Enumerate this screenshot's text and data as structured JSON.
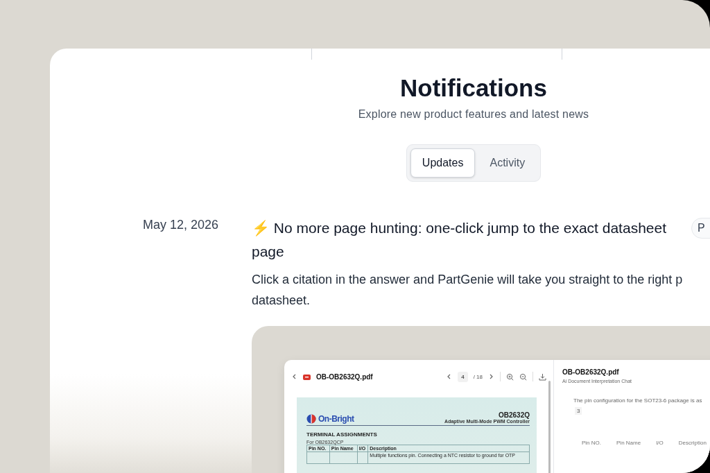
{
  "header": {
    "title": "Notifications",
    "subtitle": "Explore new product features and latest news"
  },
  "tabs": [
    {
      "label": "Updates",
      "selected": true
    },
    {
      "label": "Activity",
      "selected": false
    }
  ],
  "entries": [
    {
      "date": "May 12, 2026",
      "title": "⚡ No more page hunting: one-click jump to the exact datasheet page",
      "tag": "P",
      "body_lines": [
        "Click a citation in the answer and PartGenie will take you straight to the right p",
        "datasheet."
      ],
      "screenshot": {
        "file_name": "OB-OB2632Q.pdf",
        "page": "4",
        "page_total": "/ 18",
        "document": {
          "brand": "On-Bright",
          "part": "OB2632Q",
          "part_subtitle": "Adaptive Multi-Mode PWM Controller",
          "section": "TERMINAL ASSIGNMENTS",
          "variant": "For OB2632QCP",
          "columns": [
            "Pin NO.",
            "Pin Name",
            "I/O",
            "Description"
          ],
          "description": "Multiple functions pin. Connecting a NTC resistor to ground for OTP"
        },
        "chat": {
          "title": "OB-OB2632Q.pdf",
          "subtitle": "Ai Document Interpretation Chat",
          "answer": "The pin configuration for the SOT23-6 package is as",
          "citation": "3",
          "columns": [
            "Pin NO.",
            "Pin Name",
            "I/O",
            "Description"
          ]
        }
      }
    }
  ]
}
